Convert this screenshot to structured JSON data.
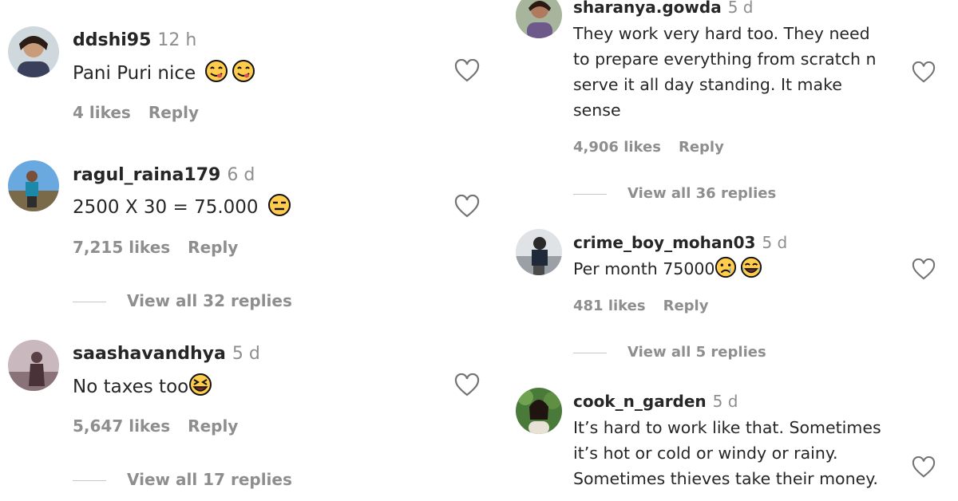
{
  "left_comments": [
    {
      "username": "ddshi95",
      "time": "12 h",
      "text": "Pani Puri nice",
      "likes": "4 likes",
      "reply": "Reply",
      "emoji": [
        "yum",
        "yum"
      ]
    },
    {
      "username": "ragul_raina179",
      "time": "6 d",
      "text": "2500 X 30 = 75.000",
      "likes": "7,215 likes",
      "reply": "Reply",
      "emoji": [
        "expressionless"
      ],
      "view_replies": "View all 32 replies"
    },
    {
      "username": "saashavandhya",
      "time": "5 d",
      "text": "No taxes too",
      "likes": "5,647 likes",
      "reply": "Reply",
      "emoji": [
        "laughing"
      ],
      "view_replies": "View all 17 replies"
    }
  ],
  "right_comments": [
    {
      "username": "sharanya.gowda",
      "time": "5 d",
      "text_lines": [
        "They work very hard too. They need",
        "to prepare everything from scratch n",
        "serve it all day standing. It make",
        "sense"
      ],
      "likes": "4,906 likes",
      "reply": "Reply",
      "view_replies": "View all 36 replies"
    },
    {
      "username": "crime_boy_mohan03",
      "time": "5 d",
      "text": "Per month 75000",
      "likes": "481 likes",
      "reply": "Reply",
      "emoji": [
        "crying",
        "joy"
      ],
      "view_replies": "View all 5 replies"
    },
    {
      "username": "cook_n_garden",
      "time": "5 d",
      "text_lines": [
        "It’s hard to work like that. Sometimes",
        "it’s hot or cold or windy or rainy.",
        "Sometimes thieves take their money."
      ]
    }
  ],
  "colors": {
    "text": "#262626",
    "secondary": "#8e8e8e",
    "emoji": "#ffcc4d"
  }
}
